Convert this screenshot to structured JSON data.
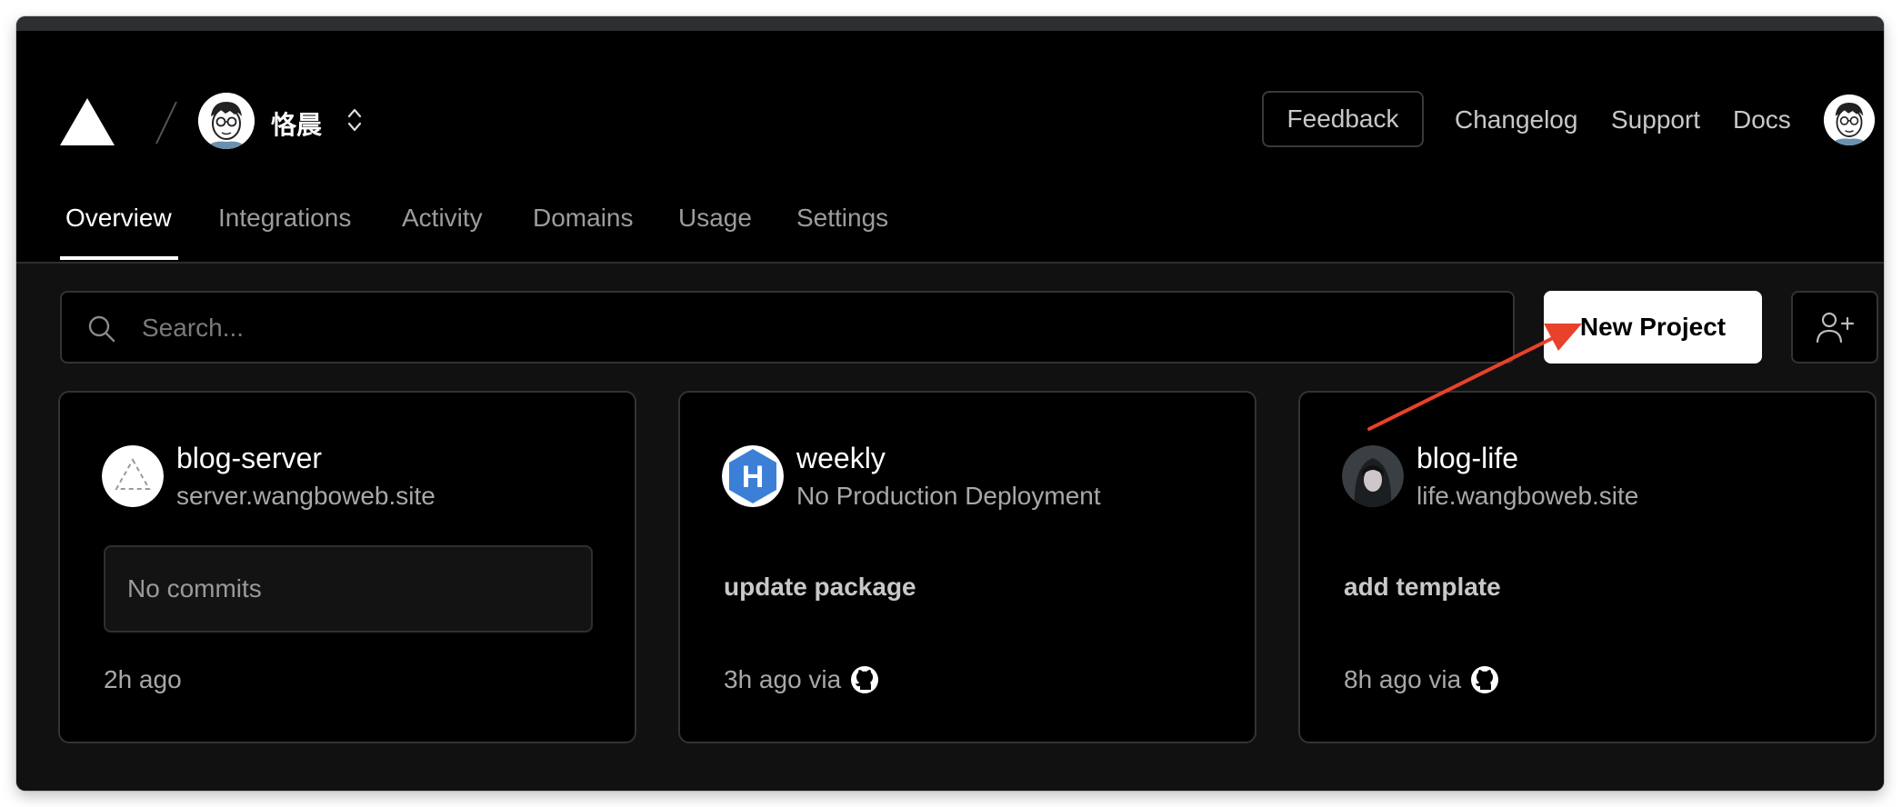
{
  "header": {
    "team_name": "恪晨",
    "feedback_label": "Feedback",
    "links": [
      "Changelog",
      "Support",
      "Docs"
    ]
  },
  "tabs": [
    {
      "label": "Overview",
      "active": true
    },
    {
      "label": "Integrations",
      "active": false
    },
    {
      "label": "Activity",
      "active": false
    },
    {
      "label": "Domains",
      "active": false
    },
    {
      "label": "Usage",
      "active": false
    },
    {
      "label": "Settings",
      "active": false
    }
  ],
  "search": {
    "placeholder": "Search..."
  },
  "actions": {
    "new_project_label": "New Project",
    "invite_icon": "user-plus-icon"
  },
  "projects": [
    {
      "name": "blog-server",
      "domain": "server.wangboweb.site",
      "commit": "No commits",
      "time": "2h ago",
      "icon": "triangle-dashed-icon"
    },
    {
      "name": "weekly",
      "domain": "No Production Deployment",
      "commit": "update package",
      "time": "3h ago via",
      "icon": "hexagon-h-icon",
      "source_icon": "github-icon"
    },
    {
      "name": "blog-life",
      "domain": "life.wangboweb.site",
      "commit": "add template",
      "time": "8h ago via",
      "icon": "hooded-avatar",
      "source_icon": "github-icon"
    }
  ],
  "colors": {
    "background": "#000000",
    "surface": "#111111",
    "border": "#333333",
    "annotation_arrow": "#e8412c",
    "weekly_icon": "#3b80d6"
  }
}
